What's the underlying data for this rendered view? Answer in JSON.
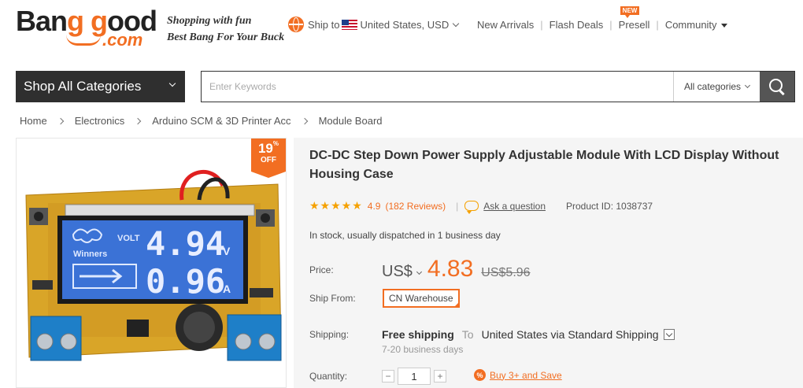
{
  "logo": {
    "brand_part1": "Ban",
    "brand_g1": "g",
    "brand_part2": " ",
    "brand_g2": "g",
    "brand_part3": "ood",
    "domain": ".com"
  },
  "slogan": {
    "line1": "Shopping with fun",
    "line2": "Best Bang For Your Buck"
  },
  "ship_to": {
    "label": "Ship to",
    "country": "United States",
    "currency": ", USD"
  },
  "topnav": {
    "new_arrivals": "New Arrivals",
    "flash_deals": "Flash Deals",
    "presell": "Presell",
    "presell_badge": "NEW",
    "community": "Community",
    "separator": "|"
  },
  "search": {
    "category_button": "Shop All Categories",
    "placeholder": "Enter Keywords",
    "scope": "All categories"
  },
  "breadcrumb": [
    "Home",
    "Electronics",
    "Arduino SCM & 3D Printer Acc",
    "Module Board"
  ],
  "discount": {
    "value": "19",
    "unit": "%",
    "off": "OFF"
  },
  "product": {
    "title": "DC-DC Step Down Power Supply Adjustable Module With LCD Display Without Housing Case",
    "rating_stars": "★★★★★",
    "rating": "4.9",
    "reviews": "(182 Reviews)",
    "rating_separator": "|",
    "ask": "Ask a question",
    "product_id": "Product ID: 1038737",
    "stock": "In stock, usually dispatched in 1 business day",
    "price_label": "Price:",
    "currency": "US$",
    "price": "4.83",
    "old_price": "US$5.96",
    "ship_from_label": "Ship From:",
    "warehouse": "CN Warehouse",
    "shipping_label": "Shipping:",
    "free_shipping": "Free shipping",
    "to": "To",
    "destination": "United States via Standard Shipping",
    "delivery_time": "7-20 business days",
    "quantity_label": "Quantity:",
    "quantity": "1",
    "minus": "−",
    "plus": "+",
    "save_icon": "%",
    "save_text": "Buy 3+ and Save"
  },
  "lcd": {
    "brand": "Winners",
    "mode": "VOLT",
    "voltage": "4.94",
    "voltage_unit": "V",
    "current": "0.96",
    "current_unit": "A"
  },
  "colors": {
    "accent": "#f26e22",
    "dark": "#2f2f2f",
    "star": "#f5a100",
    "pcb": "#d9a528",
    "lcd": "#2b63c9",
    "terminal": "#1e7fc8"
  },
  "icons": [
    "globe-icon",
    "us-flag-icon",
    "chevron-down-icon",
    "search-icon",
    "star-icon",
    "chat-bubble-icon",
    "dropdown-icon",
    "percent-icon"
  ]
}
